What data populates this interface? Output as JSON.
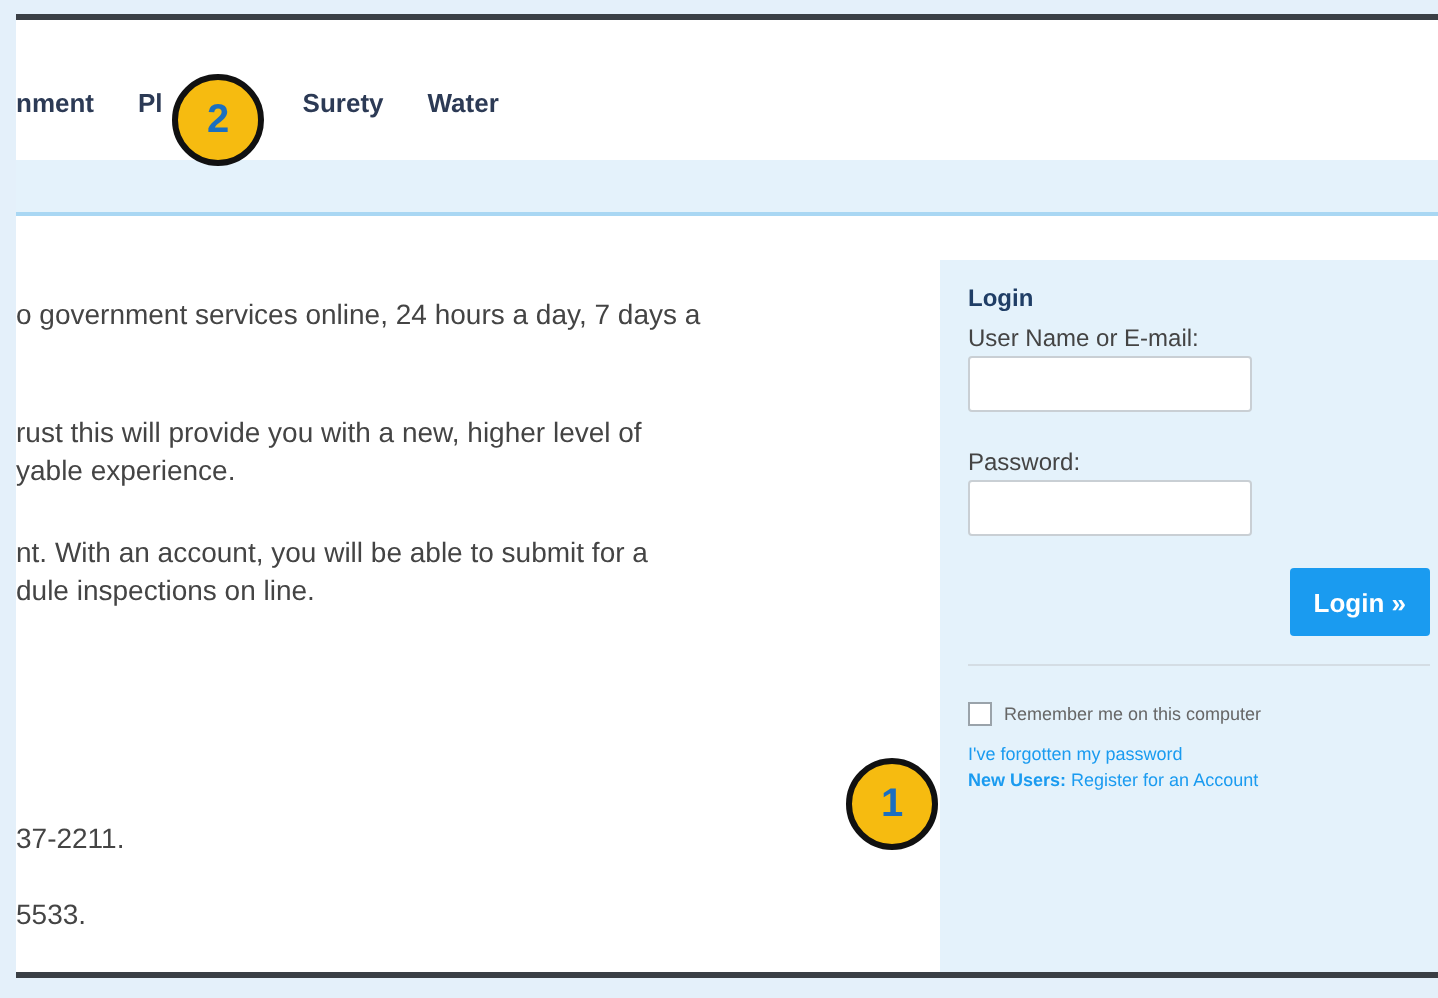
{
  "nav": {
    "items": [
      {
        "label": "nment"
      },
      {
        "label": "Pl"
      },
      {
        "label": "Surety"
      },
      {
        "label": "Water"
      }
    ]
  },
  "callouts": [
    {
      "label": "2"
    },
    {
      "label": "1"
    }
  ],
  "content": {
    "paragraphs": [
      {
        "lines": [
          "o government services online, 24 hours a day, 7 days a"
        ]
      },
      {
        "lines": [
          "rust this will provide you with a new, higher level of",
          "yable experience."
        ]
      },
      {
        "lines": [
          "nt. With an account, you will be able to submit for a",
          "dule inspections on line."
        ]
      }
    ],
    "contacts": [
      "37-2211.",
      "5533."
    ]
  },
  "login": {
    "title": "Login",
    "username_label": "User Name or E-mail:",
    "password_label": "Password:",
    "button": "Login »",
    "remember": {
      "label": "Remember me on this computer",
      "checked": false
    },
    "links": [
      "I've forgotten my password",
      "**New Users:** Register for an Account"
    ]
  }
}
